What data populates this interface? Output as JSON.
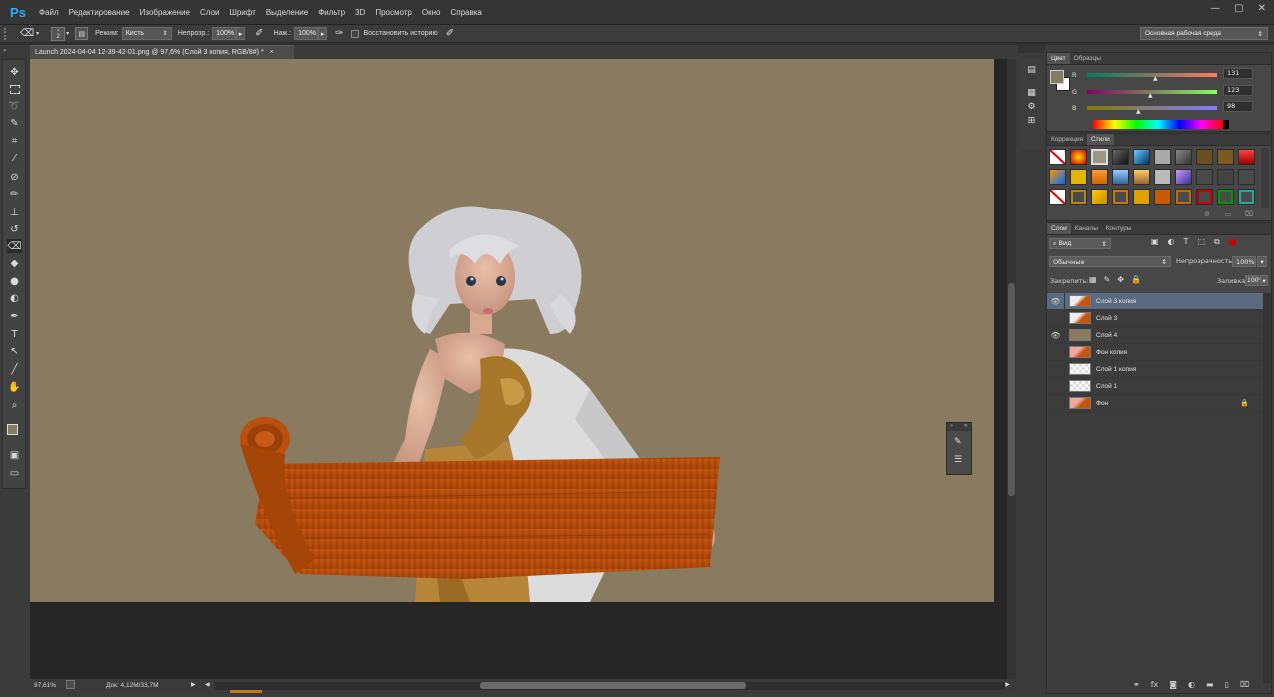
{
  "app": {
    "logo": "Ps"
  },
  "menu": [
    "Файл",
    "Редактирование",
    "Изображение",
    "Слои",
    "Шрифт",
    "Выделение",
    "Фильтр",
    "3D",
    "Просмотр",
    "Окно",
    "Справка"
  ],
  "window_controls": {
    "minimize": "—",
    "maximize": "▢",
    "close": "✕"
  },
  "options": {
    "brush_size": "2",
    "mode_label": "Режим:",
    "mode_value": "Кисть",
    "opacity_label": "Непрозр.:",
    "opacity_value": "100%",
    "pressure_label": "Наж.:",
    "pressure_value": "100%",
    "restore_history": "Восстановить историю",
    "workspace": "Основная рабочая среда"
  },
  "document": {
    "tab_title": "Launch 2024-04-04 12-39-42-01.png @ 97,6% (Слой 3 копия, RGB/8#) *",
    "tab_close": "×",
    "zoom": "97,61%",
    "doc_info": "Док: 4,12M/33,7M",
    "canvas_color": "#8a7a60"
  },
  "color_panel": {
    "tabs": [
      "Цвет",
      "Образцы"
    ],
    "active_tab": "Цвет",
    "r_label": "R",
    "r": "131",
    "g_label": "G",
    "g": "123",
    "b_label": "B",
    "b": "98",
    "fg_color": "#837b62",
    "bg_color": "#ffffff"
  },
  "styles_panel": {
    "tabs": [
      "Коррекция",
      "Стили"
    ],
    "active_tab": "Стили"
  },
  "layers_panel": {
    "tabs": [
      "Слои",
      "Каналы",
      "Контуры"
    ],
    "active_tab": "Слои",
    "filter_kind": "Вид",
    "blend_mode": "Обычные",
    "opacity_label": "Непрозрачность:",
    "opacity_value": "100%",
    "lock_label": "Закрепить:",
    "fill_label": "Заливка:",
    "fill_value": "100%",
    "layers": [
      {
        "name": "Слой 3 копия",
        "visible": true,
        "selected": true
      },
      {
        "name": "Слой 3",
        "visible": false,
        "selected": false
      },
      {
        "name": "Слой 4",
        "visible": true,
        "selected": false
      },
      {
        "name": "Фон копия",
        "visible": false,
        "selected": false
      },
      {
        "name": "Слой 1 копия",
        "visible": false,
        "selected": false
      },
      {
        "name": "Слой 1",
        "visible": false,
        "selected": false
      },
      {
        "name": "Фон",
        "visible": false,
        "selected": false,
        "locked": true
      }
    ],
    "footer_icons": [
      "link-icon",
      "fx-icon",
      "mask-icon",
      "adjustment-icon",
      "folder-icon",
      "new-layer-icon",
      "trash-icon"
    ]
  },
  "tools": [
    "move-icon",
    "marquee-icon",
    "lasso-icon",
    "quick-select-icon",
    "crop-icon",
    "eyedropper-icon",
    "healing-icon",
    "brush-icon",
    "stamp-icon",
    "history-brush-icon",
    "eraser-icon",
    "bucket-icon",
    "blur-icon",
    "dodge-icon",
    "pen-icon",
    "type-icon",
    "path-select-icon",
    "line-icon",
    "hand-icon",
    "zoom-icon"
  ]
}
